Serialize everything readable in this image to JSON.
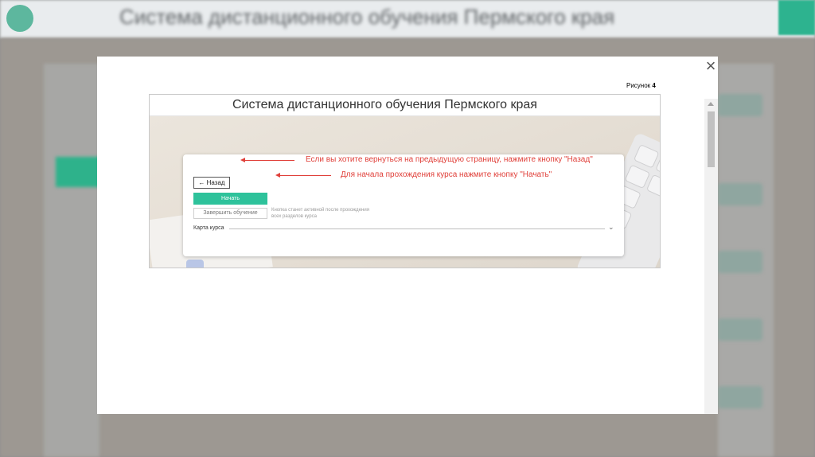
{
  "background": {
    "site_title": "Система дистанционного обучения Пермского края"
  },
  "modal": {
    "close_icon": "×",
    "caption_prefix": "Рисунок",
    "caption_number": "4"
  },
  "screenshot": {
    "title": "Система дистанционного обучения Пермского края",
    "back_button": "← Назад",
    "start_button": "Начать",
    "finish_button": "Завершить обучение",
    "finish_note": "Кнопка станет активной после прохождения всех разделов курса",
    "course_map_label": "Карта курса",
    "course_map_chevron": "⌄",
    "annotation_back": "Если вы хотите вернуться на предыдущую страницу, нажмите кнопку \"Назад\"",
    "annotation_start": "Для начала прохождения курса нажмите кнопку \"Начать\""
  },
  "colors": {
    "accent_green": "#2ec29b",
    "annotation_red": "#e0403a"
  }
}
